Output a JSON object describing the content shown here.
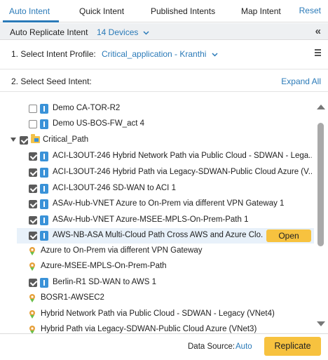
{
  "tabs": [
    {
      "label": "Auto Intent",
      "active": true
    },
    {
      "label": "Quick Intent",
      "active": false
    },
    {
      "label": "Published Intents",
      "active": false
    },
    {
      "label": "Map Intent",
      "active": false
    }
  ],
  "reset_label": "Reset",
  "replicate_bar": {
    "title": "Auto Replicate Intent",
    "devices": "14 Devices",
    "collapse_icon": "double-chevron-left-icon"
  },
  "profile": {
    "label": "1. Select Intent Profile:",
    "value": "Critical_application - Kranthi"
  },
  "seed": {
    "label": "2. Select Seed Intent:",
    "expand_all": "Expand All"
  },
  "tree": {
    "items": [
      {
        "label": "Demo CA-TOR-R2",
        "checked": false,
        "icon": "info-icon"
      },
      {
        "label": "Demo US-BOS-FW_act 4",
        "checked": false,
        "icon": "info-icon"
      },
      {
        "label": "Critical_Path",
        "checked": true,
        "icon": "folder-icon",
        "expanded": true
      },
      {
        "label": "ACI-L3OUT-246 Hybrid Network Path via Public Cloud - SDWAN - Lega...",
        "checked": true,
        "icon": "info-icon"
      },
      {
        "label": "ACI-L3OUT-246 Hybrid Path via Legacy-SDWAN-Public Cloud Azure (V...",
        "checked": true,
        "icon": "info-icon"
      },
      {
        "label": "ACI-L3OUT-246 SD-WAN to ACI 1",
        "checked": true,
        "icon": "info-icon"
      },
      {
        "label": "ASAv-Hub-VNET Azure to On-Prem via different VPN Gateway 1",
        "checked": true,
        "icon": "info-icon"
      },
      {
        "label": "ASAv-Hub-VNET Azure-MSEE-MPLS-On-Prem-Path 1",
        "checked": true,
        "icon": "info-icon"
      },
      {
        "label": "AWS-NB-ASA Multi-Cloud Path Cross AWS and Azure Clo...",
        "checked": true,
        "icon": "info-icon",
        "highlight": true
      },
      {
        "label": "Azure to On-Prem via different VPN Gateway",
        "icon": "pin-icon"
      },
      {
        "label": "Azure-MSEE-MPLS-On-Prem-Path",
        "icon": "pin-icon"
      },
      {
        "label": "Berlin-R1 SD-WAN to AWS 1",
        "checked": true,
        "icon": "info-icon"
      },
      {
        "label": "BOSR1-AWSEC2",
        "icon": "pin-icon"
      },
      {
        "label": "Hybrid Network Path via Public Cloud - SDWAN - Legacy (VNet4)",
        "icon": "pin-icon"
      },
      {
        "label": "Hybrid Path via Legacy-SDWAN-Public Cloud Azure (VNet3)",
        "icon": "pin-icon"
      }
    ],
    "open_label": "Open"
  },
  "footer": {
    "data_source_label": "Data Source:",
    "data_source_value": "Auto",
    "replicate_label": "Replicate"
  },
  "colors": {
    "accent": "#2a7ab8",
    "button": "#f7c23f",
    "info_icon": "#3a92d8",
    "folder": "#f2c24a"
  }
}
